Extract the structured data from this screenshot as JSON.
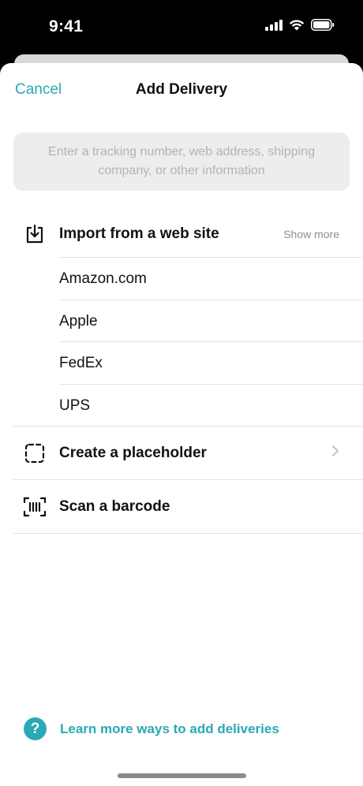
{
  "status_bar": {
    "time": "9:41"
  },
  "nav": {
    "cancel_label": "Cancel",
    "title": "Add Delivery"
  },
  "search": {
    "placeholder": "Enter a tracking number, web address, shipping company, or other information"
  },
  "import_section": {
    "title": "Import from a web site",
    "show_more_label": "Show more",
    "icon": "download-tray-icon",
    "sites": [
      {
        "label": "Amazon.com"
      },
      {
        "label": "Apple"
      },
      {
        "label": "FedEx"
      },
      {
        "label": "UPS"
      }
    ]
  },
  "placeholder_row": {
    "label": "Create a placeholder",
    "icon": "dashed-square-icon"
  },
  "barcode_row": {
    "label": "Scan a barcode",
    "icon": "barcode-scan-icon"
  },
  "footer": {
    "learn_more_label": "Learn more ways to add deliveries",
    "icon": "question-circle-icon"
  },
  "colors": {
    "accent": "#2aa8b6",
    "placeholder_text": "#b3b3b3",
    "search_bg": "#ededed"
  }
}
